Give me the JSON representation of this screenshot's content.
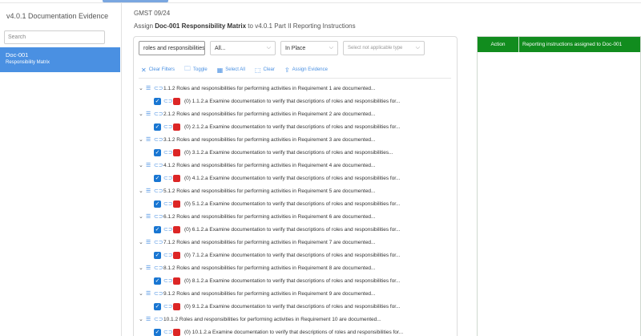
{
  "sidebar": {
    "title": "v4.0.1 Documentation Evidence",
    "search_placeholder": "Search",
    "doc": {
      "name": "Doc-001",
      "subtitle": "Responsibility Matrix"
    }
  },
  "header": {
    "code": "GMST 09/24",
    "assign_prefix": "Assign",
    "doc_label": "Doc-001 Responsibility Matrix",
    "assign_suffix": "to v4.0.1 Part II Reporting Instructions"
  },
  "filters": {
    "search_value": "roles and responsibilities",
    "select1": "All...",
    "select2": "In Place",
    "select3_placeholder": "Select not applicable type"
  },
  "toolbar": {
    "clear_filters": "Clear Filters",
    "toggle": "Toggle",
    "select_all": "Select All",
    "clear": "Clear",
    "assign_evidence": "Assign Evidence"
  },
  "tree": [
    {
      "parent": "1.1.2 Roles and responsibilities for performing activities in Requirement 1 are documented...",
      "child": "(0) 1.1.2.a Examine documentation to verify that descriptions of roles and responsibilities for..."
    },
    {
      "parent": "2.1.2 Roles and responsibilities for performing activities in Requirement 2 are documented...",
      "child": "(0) 2.1.2.a Examine documentation to verify that descriptions of roles and responsibilities for..."
    },
    {
      "parent": "3.1.2 Roles and responsibilities for performing activities in Requirement 3 are documented...",
      "child": "(0) 3.1.2.a Examine documentation to verify that descriptions of roles and responsibilities..."
    },
    {
      "parent": "4.1.2 Roles and responsibilities for performing activities in Requirement 4 are documented...",
      "child": "(0) 4.1.2.a Examine documentation to verify that descriptions of roles and responsibilities for..."
    },
    {
      "parent": "5.1.2 Roles and responsibilities for performing activities in Requirement 5 are documented...",
      "child": "(0) 5.1.2.a Examine documentation to verify that descriptions of roles and responsibilities for..."
    },
    {
      "parent": "6.1.2 Roles and responsibilities for performing activities in Requirement 6 are documented...",
      "child": "(0) 6.1.2.a Examine documentation to verify that descriptions of roles and responsibilities for..."
    },
    {
      "parent": "7.1.2 Roles and responsibilities for performing activities in Requirement 7 are documented...",
      "child": "(0) 7.1.2.a Examine documentation to verify that descriptions of roles and responsibilities for..."
    },
    {
      "parent": "8.1.2 Roles and responsibilities for performing activities in Requirement 8 are documented...",
      "child": "(0) 8.1.2.a Examine documentation to verify that descriptions of roles and responsibilities for..."
    },
    {
      "parent": "9.1.2 Roles and responsibilities for performing activities in Requirement 9 are documented...",
      "child": "(0) 9.1.2.a Examine documentation to verify that descriptions of roles and responsibilities for..."
    },
    {
      "parent": "10.1.2 Roles and responsibilities for performing activities in Requirement 10 are documented...",
      "child": "(0) 10.1.2.a Examine documentation to verify that descriptions of roles and responsibilities for..."
    }
  ],
  "right_panel": {
    "col_action": "Action",
    "col_instructions": "Reporting instructions assigned to Doc-001",
    "header_color": "#118c1e"
  },
  "colors": {
    "accent": "#4a90e2",
    "checkbox": "#1976d2",
    "status_red": "#dc2626"
  }
}
